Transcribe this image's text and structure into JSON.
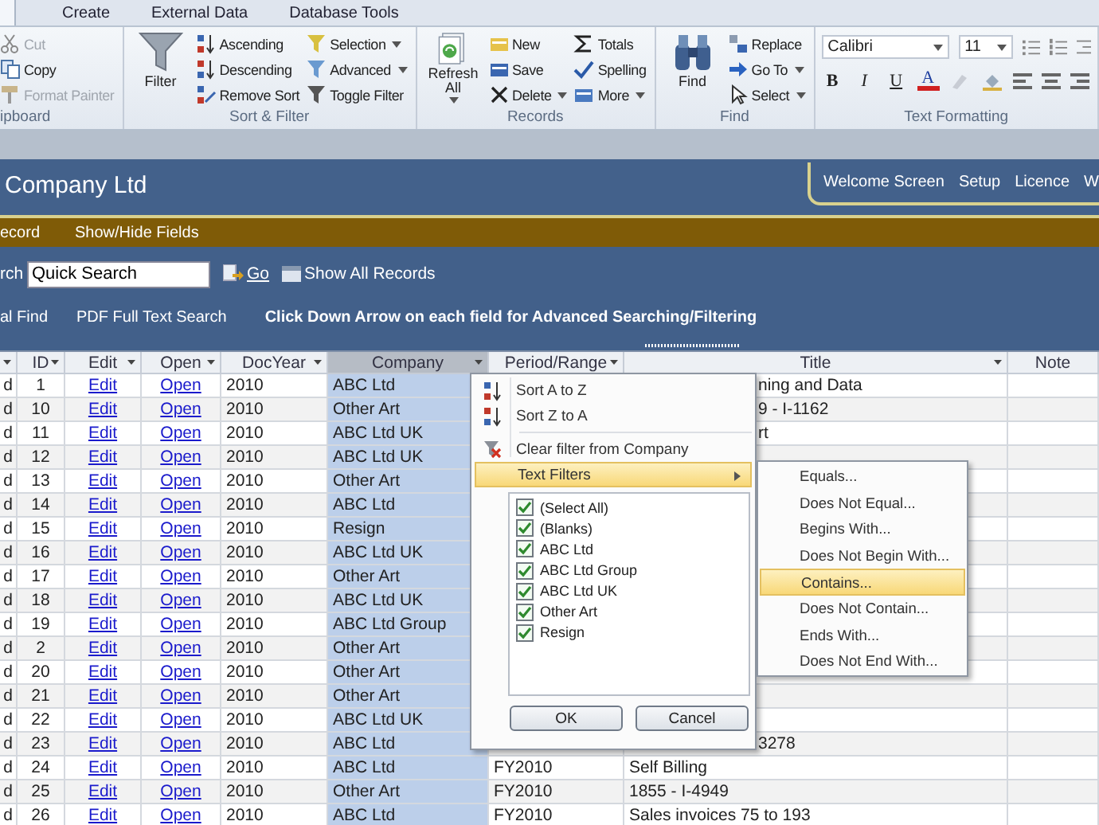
{
  "ribbon": {
    "tabs": [
      {
        "label": "Create",
        "selected": false
      },
      {
        "label": "External Data",
        "selected": false
      },
      {
        "label": "Database Tools",
        "selected": false
      }
    ],
    "groups": [
      {
        "label": "ipboard",
        "columns": [
          [
            {
              "label": "Cut",
              "kind": "cut",
              "disabled": true
            },
            {
              "label": "Copy",
              "kind": "copy",
              "disabled": false
            },
            {
              "label": "Format Painter",
              "kind": "painter",
              "disabled": true
            }
          ]
        ]
      },
      {
        "label": "Sort & Filter",
        "large": {
          "label": "Filter",
          "kind": "funnel"
        },
        "columns": [
          [
            {
              "label": "Ascending",
              "kind": "asc",
              "disabled": false
            },
            {
              "label": "Descending",
              "kind": "desc",
              "disabled": false
            },
            {
              "label": "Remove Sort",
              "kind": "removesort",
              "disabled": false
            }
          ],
          [
            {
              "label": "Selection",
              "kind": "selection",
              "dropdown": true,
              "disabled": false
            },
            {
              "label": "Advanced",
              "kind": "advanced",
              "dropdown": true,
              "disabled": false
            },
            {
              "label": "Toggle Filter",
              "kind": "toggle",
              "disabled": false
            }
          ]
        ]
      },
      {
        "label": "Records",
        "large": {
          "label": "Refresh All",
          "kind": "refresh",
          "dropdown": true
        },
        "columns": [
          [
            {
              "label": "New",
              "kind": "new",
              "disabled": false
            },
            {
              "label": "Save",
              "kind": "save",
              "disabled": false
            },
            {
              "label": "Delete",
              "kind": "delete",
              "dropdown": true,
              "disabled": false
            }
          ],
          [
            {
              "label": "Totals",
              "kind": "totals",
              "disabled": false
            },
            {
              "label": "Spelling",
              "kind": "spelling",
              "disabled": false
            },
            {
              "label": "More",
              "kind": "more",
              "dropdown": true,
              "disabled": false
            }
          ]
        ]
      },
      {
        "label": "Find",
        "large": {
          "label": "Find",
          "kind": "binoculars"
        },
        "columns": [
          [
            {
              "label": "Replace",
              "kind": "replace",
              "disabled": false
            },
            {
              "label": "Go To",
              "kind": "goto",
              "dropdown": true,
              "disabled": false
            },
            {
              "label": "Select",
              "kind": "select",
              "dropdown": true,
              "disabled": false
            }
          ]
        ]
      }
    ],
    "text_formatting": {
      "label": "Text Formatting",
      "font": "Calibri",
      "size": "11",
      "styles": [
        "B",
        "I",
        "U"
      ],
      "font_color": "A"
    }
  },
  "header": {
    "title": "Company Ltd",
    "links": [
      "Welcome Screen",
      "Setup",
      "Licence",
      "W"
    ]
  },
  "command_bar": [
    "ecord",
    "Show/Hide Fields"
  ],
  "search": {
    "label": "rch",
    "value": "Quick Search",
    "go": "Go",
    "show_all": "Show All Records",
    "links": [
      "al Find",
      "PDF Full Text Search"
    ],
    "hint": "Click Down Arrow on each field for Advanced Searching/Filtering"
  },
  "table": {
    "columns": [
      {
        "selected": false
      },
      {
        "label": "ID",
        "selected": false
      },
      {
        "label": "Edit",
        "selected": false
      },
      {
        "label": "Open",
        "selected": false
      },
      {
        "label": "DocYear",
        "selected": false
      },
      {
        "label": "Company",
        "selected": true
      },
      {
        "label": "Period/Range",
        "selected": false
      },
      {
        "label": "Title",
        "selected": false
      },
      {
        "label": "Note",
        "selected": false
      }
    ],
    "rows": [
      {
        "column_1": "d",
        "id": "1",
        "edit": "Edit",
        "open": "Open",
        "docyear": "2010",
        "company": "ABC Ltd",
        "title": "ning and Data"
      },
      {
        "column_1": "d",
        "id": "10",
        "edit": "Edit",
        "open": "Open",
        "docyear": "2010",
        "company": "Other Art",
        "title": "9 - I-1162"
      },
      {
        "column_1": "d",
        "id": "11",
        "edit": "Edit",
        "open": "Open",
        "docyear": "2010",
        "company": "ABC Ltd UK",
        "title": "rt"
      },
      {
        "column_1": "d",
        "id": "12",
        "edit": "Edit",
        "open": "Open",
        "docyear": "2010",
        "company": "ABC Ltd UK"
      },
      {
        "column_1": "d",
        "id": "13",
        "edit": "Edit",
        "open": "Open",
        "docyear": "2010",
        "company": "Other Art"
      },
      {
        "column_1": "d",
        "id": "14",
        "edit": "Edit",
        "open": "Open",
        "docyear": "2010",
        "company": "ABC Ltd"
      },
      {
        "column_1": "d",
        "id": "15",
        "edit": "Edit",
        "open": "Open",
        "docyear": "2010",
        "company": "Resign"
      },
      {
        "column_1": "d",
        "id": "16",
        "edit": "Edit",
        "open": "Open",
        "docyear": "2010",
        "company": "ABC Ltd UK"
      },
      {
        "column_1": "d",
        "id": "17",
        "edit": "Edit",
        "open": "Open",
        "docyear": "2010",
        "company": "Other Art"
      },
      {
        "column_1": "d",
        "id": "18",
        "edit": "Edit",
        "open": "Open",
        "docyear": "2010",
        "company": "ABC Ltd UK"
      },
      {
        "column_1": "d",
        "id": "19",
        "edit": "Edit",
        "open": "Open",
        "docyear": "2010",
        "company": "ABC Ltd Group"
      },
      {
        "column_1": "d",
        "id": "2",
        "edit": "Edit",
        "open": "Open",
        "docyear": "2010",
        "company": "Other Art"
      },
      {
        "column_1": "d",
        "id": "20",
        "edit": "Edit",
        "open": "Open",
        "docyear": "2010",
        "company": "Other Art"
      },
      {
        "column_1": "d",
        "id": "21",
        "edit": "Edit",
        "open": "Open",
        "docyear": "2010",
        "company": "Other Art"
      },
      {
        "column_1": "d",
        "id": "22",
        "edit": "Edit",
        "open": "Open",
        "docyear": "2010",
        "company": "ABC Ltd UK"
      },
      {
        "column_1": "d",
        "id": "23",
        "edit": "Edit",
        "open": "Open",
        "docyear": "2010",
        "company": "ABC Ltd",
        "title": "3278"
      },
      {
        "column_1": "d",
        "id": "24",
        "edit": "Edit",
        "open": "Open",
        "docyear": "2010",
        "company": "ABC Ltd",
        "period": "FY2010",
        "title": "Self Billing"
      },
      {
        "column_1": "d",
        "id": "25",
        "edit": "Edit",
        "open": "Open",
        "docyear": "2010",
        "company": "Other Art",
        "period": "FY2010",
        "title": "1855 - I-4949"
      },
      {
        "column_1": "d",
        "id": "26",
        "edit": "Edit",
        "open": "Open",
        "docyear": "2010",
        "company": "ABC Ltd",
        "period": "FY2010",
        "title": "Sales invoices  75 to 193"
      }
    ]
  },
  "filter_menu": {
    "items": [
      {
        "label": "Sort A to Z",
        "kind": "sort-asc",
        "selected": false
      },
      {
        "label": "Sort Z to A",
        "kind": "sort-desc",
        "selected": false
      },
      {
        "label": "Clear filter from Company",
        "kind": "clear",
        "selected": false
      },
      {
        "label": "Text Filters",
        "kind": "submenu",
        "selected": true
      }
    ],
    "values": [
      {
        "label": "(Select All)",
        "checked": true
      },
      {
        "label": "(Blanks)",
        "checked": true
      },
      {
        "label": "ABC Ltd",
        "checked": true
      },
      {
        "label": "ABC Ltd Group",
        "checked": true
      },
      {
        "label": "ABC Ltd UK",
        "checked": true
      },
      {
        "label": "Other Art",
        "checked": true
      },
      {
        "label": "Resign",
        "checked": true
      }
    ],
    "buttons": [
      "OK",
      "Cancel"
    ]
  },
  "text_filters_menu": [
    {
      "label": "Equals...",
      "selected": false
    },
    {
      "label": "Does Not Equal...",
      "selected": false
    },
    {
      "label": "Begins With...",
      "selected": false
    },
    {
      "label": "Does Not Begin With...",
      "selected": false
    },
    {
      "label": "Contains...",
      "selected": true
    },
    {
      "label": "Does Not Contain...",
      "selected": false
    },
    {
      "label": "Ends With...",
      "selected": false
    },
    {
      "label": "Does Not End With...",
      "selected": false
    }
  ]
}
